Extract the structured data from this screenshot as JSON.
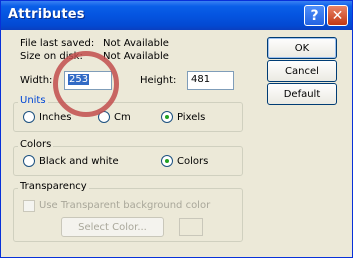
{
  "window": {
    "title": "Attributes"
  },
  "title_buttons": {
    "help": "?",
    "close": "✕"
  },
  "info": {
    "file_saved_label": "File last saved:",
    "file_saved_value": "Not Available",
    "size_label": "Size on disk:",
    "size_value": "Not Available"
  },
  "fields": {
    "width_label": "Width:",
    "width_value": "253",
    "height_label": "Height:",
    "height_value": "481"
  },
  "units": {
    "title": "Units",
    "options": [
      "Inches",
      "Cm",
      "Pixels"
    ],
    "selected": "Pixels"
  },
  "colors": {
    "title": "Colors",
    "options": [
      "Black and white",
      "Colors"
    ],
    "selected": "Colors"
  },
  "transparency": {
    "title": "Transparency",
    "checkbox_label": "Use Transparent background color",
    "select_button": "Select Color..."
  },
  "buttons": {
    "ok": "OK",
    "cancel": "Cancel",
    "default": "Default"
  }
}
